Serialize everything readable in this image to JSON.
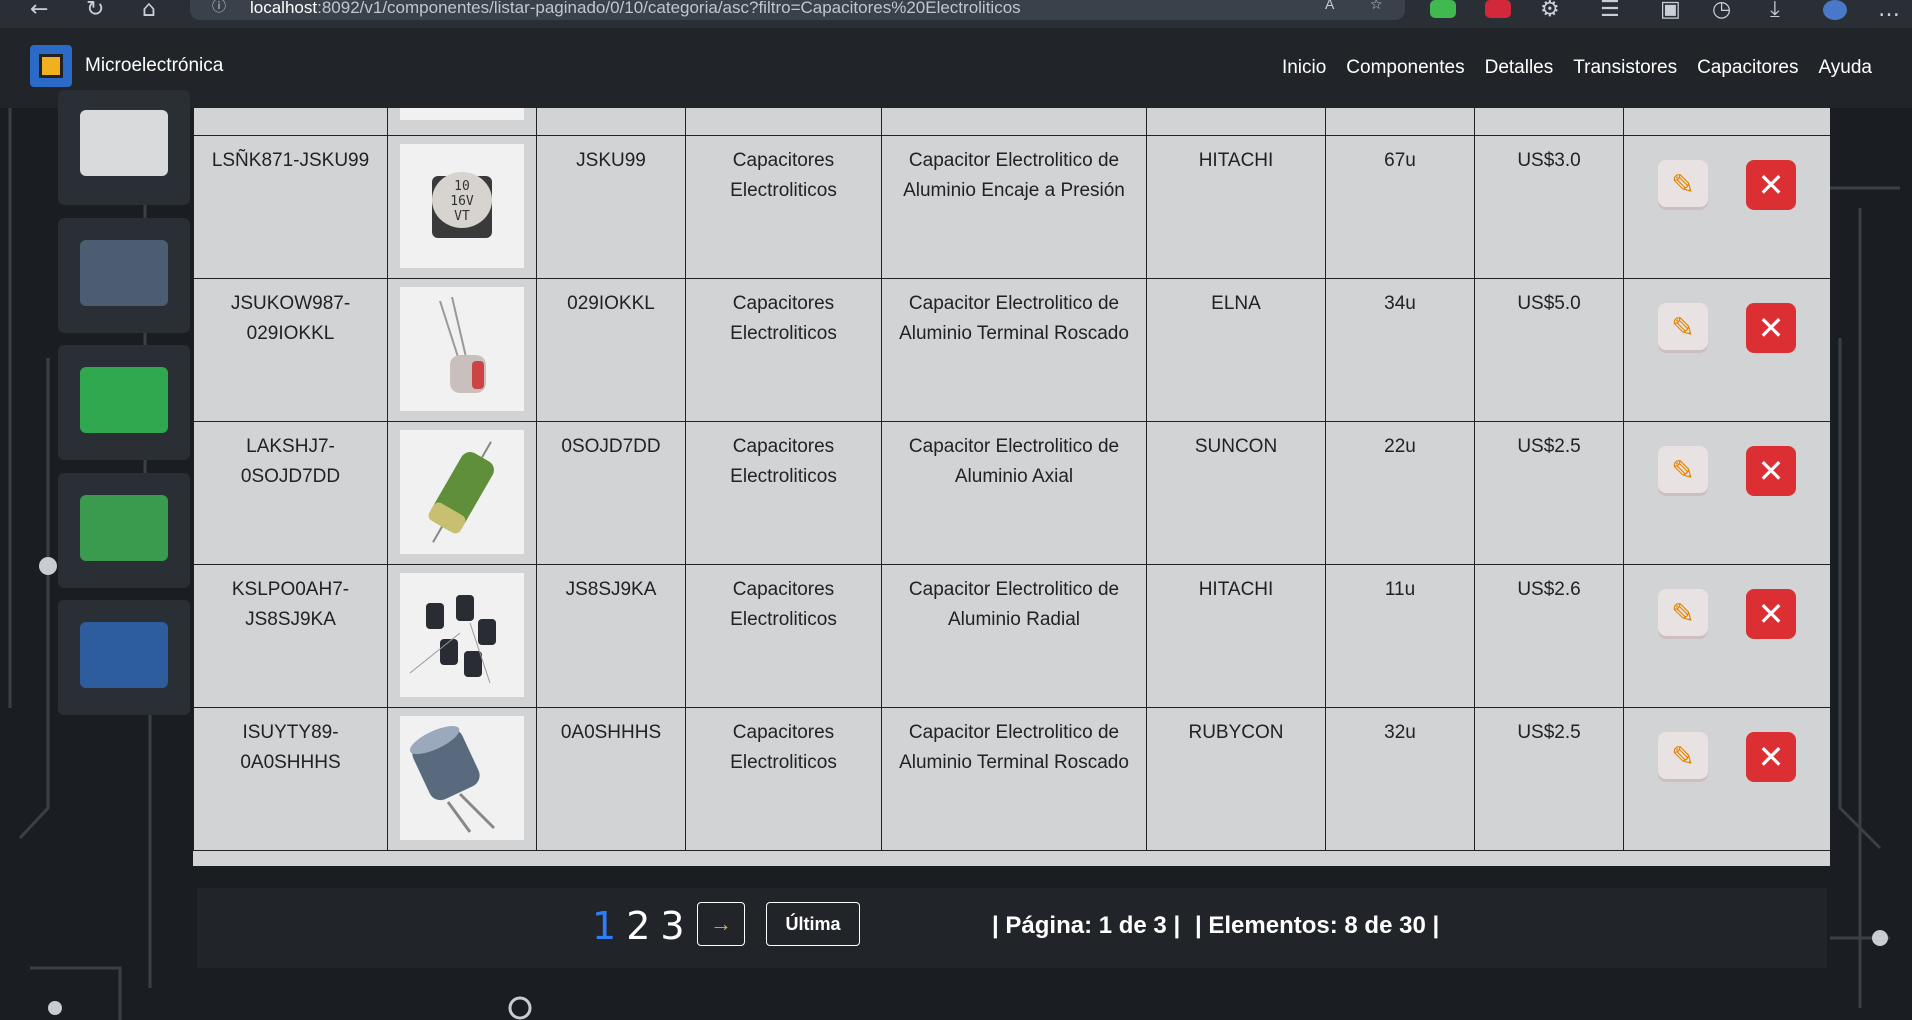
{
  "browser": {
    "url_host": "localhost",
    "url_rest": ":8092/v1/componentes/listar-paginado/0/10/categoria/asc?filtro=Capacitores%20Electroliticos"
  },
  "navbar": {
    "brand": "Microelectrónica",
    "links": [
      "Inicio",
      "Componentes",
      "Detalles",
      "Transistores",
      "Capacitores",
      "Ayuda"
    ]
  },
  "rows": [
    {
      "code": "LSÑK871-JSKU99",
      "ref": "JSKU99",
      "category": "Capacitores Electroliticos",
      "description": "Capacitor Electrolitico de Aluminio Encaje a Presión",
      "brand": "HITACHI",
      "stock": "67u",
      "price": "US$3.0"
    },
    {
      "code": "JSUKOW987-029IOKKL",
      "ref": "029IOKKL",
      "category": "Capacitores Electroliticos",
      "description": "Capacitor Electrolitico de Aluminio Terminal Roscado",
      "brand": "ELNA",
      "stock": "34u",
      "price": "US$5.0"
    },
    {
      "code": "LAKSHJ7-0SOJD7DD",
      "ref": "0SOJD7DD",
      "category": "Capacitores Electroliticos",
      "description": "Capacitor Electrolitico de Aluminio Axial",
      "brand": "SUNCON",
      "stock": "22u",
      "price": "US$2.5"
    },
    {
      "code": "KSLPO0AH7-JS8SJ9KA",
      "ref": "JS8SJ9KA",
      "category": "Capacitores Electroliticos",
      "description": "Capacitor Electrolitico de Aluminio Radial",
      "brand": "HITACHI",
      "stock": "11u",
      "price": "US$2.6"
    },
    {
      "code": "ISUYTY89-0A0SHHHS",
      "ref": "0A0SHHHS",
      "category": "Capacitores Electroliticos",
      "description": "Capacitor Electrolitico de Aluminio Terminal Roscado",
      "brand": "RUBYCON",
      "stock": "32u",
      "price": "US$2.5"
    }
  ],
  "row1_cap_label": "10\n16V\nVT",
  "pager": {
    "pages": [
      "1",
      "2",
      "3"
    ],
    "active_page": "1",
    "next_icon": "→",
    "last_label": "Última",
    "page_info": "| Página: 1 de 3 |",
    "elements_info": "| Elementos: 8 de 30 |"
  },
  "icons": {
    "edit": "pencil-icon",
    "delete": "close-icon"
  },
  "colors": {
    "navbar": "#212529",
    "active_page": "#2f7cf6",
    "delete_button": "#dc2f33",
    "arrow": "#f5a623"
  }
}
